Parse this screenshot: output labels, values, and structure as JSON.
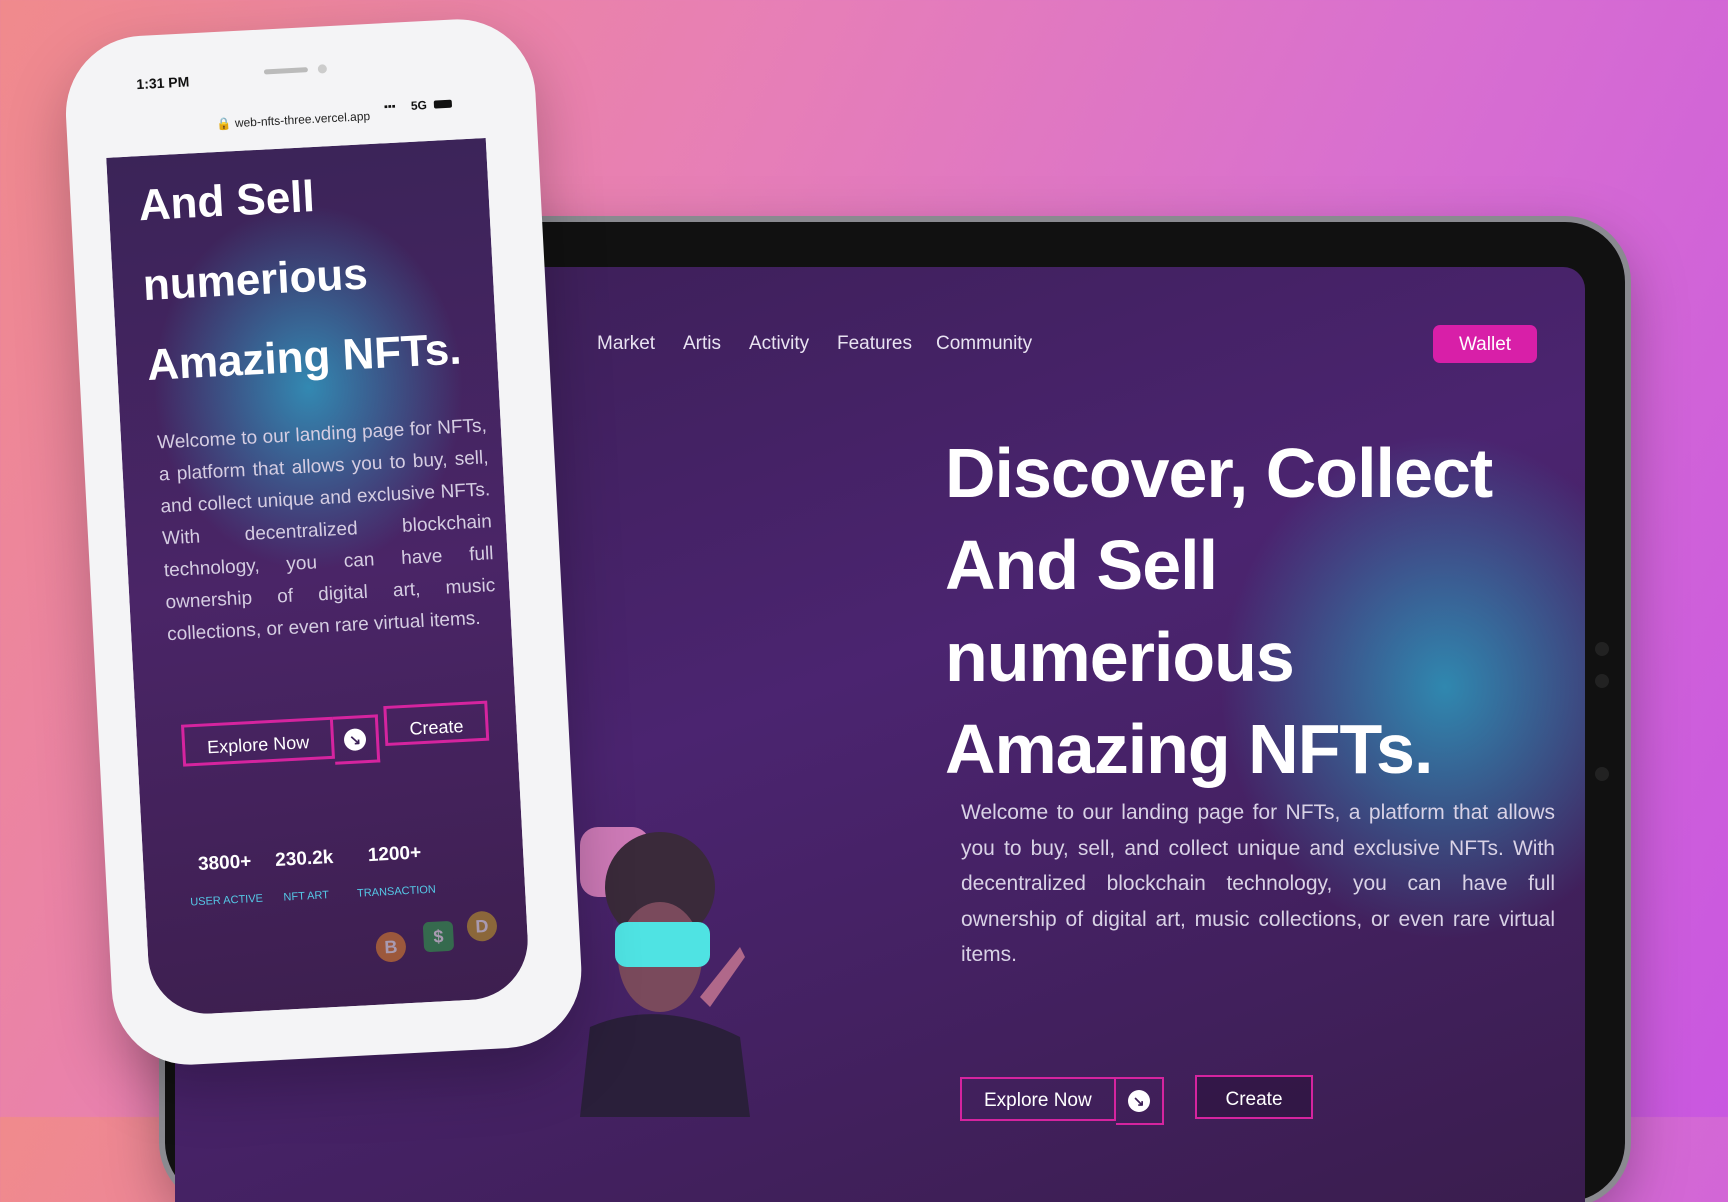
{
  "desktop": {
    "nav": {
      "items": [
        "Market",
        "Artis",
        "Activity",
        "Features",
        "Community"
      ],
      "wallet_label": "Wallet"
    },
    "hero": {
      "title_lines": [
        "Discover, Collect",
        "And Sell",
        "numerious",
        "Amazing NFTs."
      ],
      "description": "Welcome to our landing page for NFTs, a platform that allows you to buy, sell, and collect unique and exclusive NFTs. With decentralized blockchain technology, you can have full ownership of digital art, music collections, or even rare virtual items.",
      "explore_label": "Explore Now",
      "create_label": "Create"
    }
  },
  "mobile": {
    "status_time": "1:31 PM",
    "url": "web-nfts-three.vercel.app",
    "network": "5G",
    "title_lines": [
      "And Sell",
      "numerious",
      "Amazing NFTs."
    ],
    "description": "Welcome to our landing page for NFTs, a platform that allows you to buy, sell, and collect unique and exclusive NFTs. With decentralized blockchain technology, you can have full ownership of digital art, music collections, or even rare virtual items.",
    "explore_label": "Explore Now",
    "create_label": "Create",
    "stats": [
      {
        "value": "3800+",
        "label": "USER ACTIVE"
      },
      {
        "value": "230.2k",
        "label": "NFT ART"
      },
      {
        "value": "1200+",
        "label": "TRANSACTION"
      }
    ],
    "coins": [
      "B",
      "$",
      "D"
    ]
  },
  "colors": {
    "accent": "#d81fa8",
    "background_top": "#3b1f55",
    "glow": "#28aac8",
    "stat_label": "#55c8e6"
  },
  "icons": {
    "arrow": "arrow-down-right-icon",
    "lock": "lock-icon",
    "battery": "battery-icon",
    "signal": "signal-icon"
  }
}
